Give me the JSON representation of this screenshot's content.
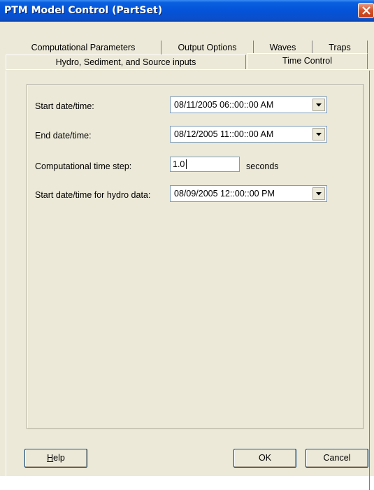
{
  "window": {
    "title": "PTM Model Control (PartSet)"
  },
  "tabs": {
    "row1": [
      "Computational Parameters",
      "Output Options",
      "Waves",
      "Traps"
    ],
    "row2": [
      "Hydro, Sediment, and Source inputs",
      "Time Control"
    ],
    "active": "Time Control"
  },
  "form": {
    "start_label": "Start date/time:",
    "start_value": "08/11/2005  06::00::00 AM",
    "end_label": "End date/time:",
    "end_value": "08/12/2005  11::00::00 AM",
    "step_label": "Computational time step:",
    "step_value": "1.0",
    "step_unit": "seconds",
    "hydro_label": "Start date/time for hydro data:",
    "hydro_value": "08/09/2005  12::00::00 PM"
  },
  "buttons": {
    "help_first": "H",
    "help_rest": "elp",
    "ok": "OK",
    "cancel": "Cancel"
  },
  "icons": {
    "close": "close-icon",
    "dropdown": "chevron-down-icon"
  }
}
